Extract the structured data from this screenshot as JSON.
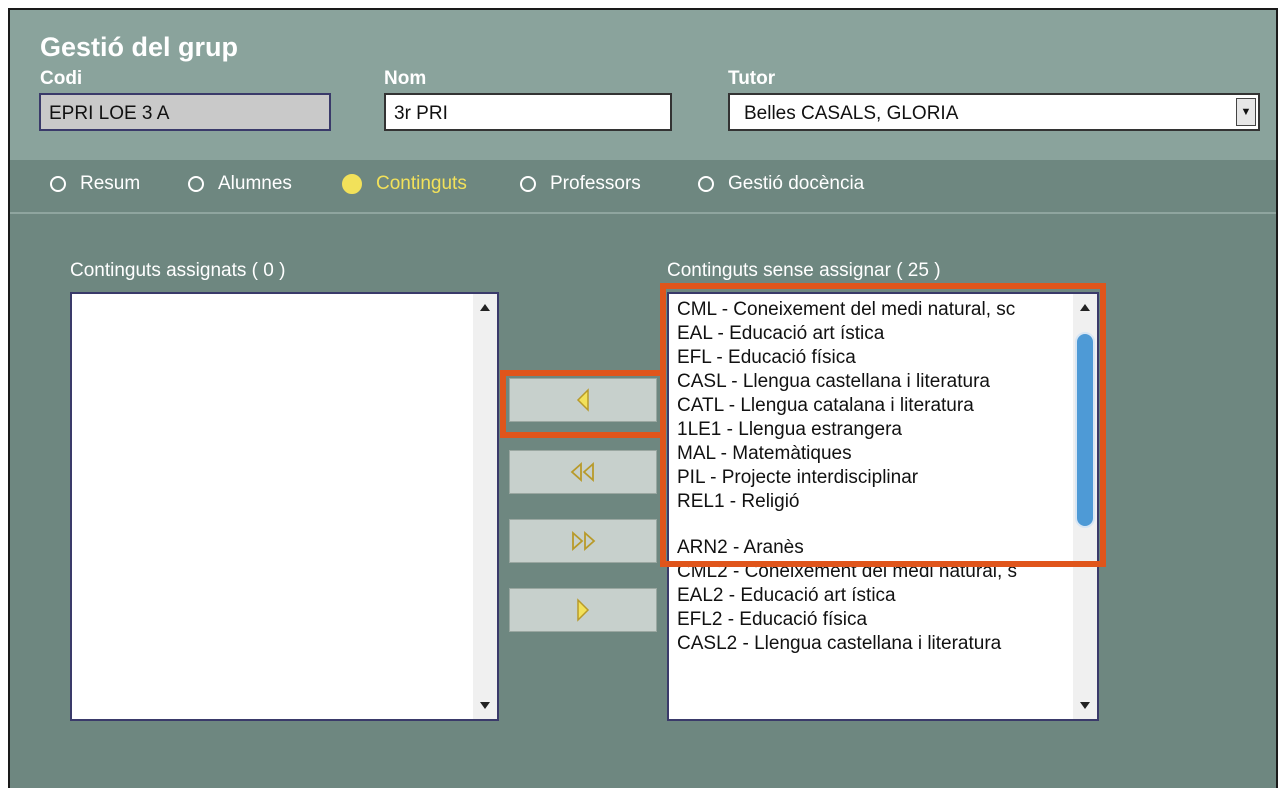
{
  "header": {
    "title": "Gestió del grup",
    "codi_label": "Codi",
    "codi_value": "EPRI LOE 3 A",
    "nom_label": "Nom",
    "nom_value": "3r PRI",
    "tutor_label": "Tutor",
    "tutor_value": "Belles CASALS, GLORIA"
  },
  "tabs": [
    {
      "label": "Resum",
      "selected": false
    },
    {
      "label": "Alumnes",
      "selected": false
    },
    {
      "label": "Continguts",
      "selected": true
    },
    {
      "label": "Professors",
      "selected": false
    },
    {
      "label": "Gestió docència",
      "selected": false
    }
  ],
  "assigned": {
    "label": "Continguts assignats ( 0 )",
    "items": []
  },
  "unassigned": {
    "label": "Continguts sense assignar ( 25 )",
    "items": [
      "CML - Coneixement del medi natural, sc",
      "EAL - Educació art ística",
      "EFL - Educació física",
      "CASL - Llengua castellana i literatura",
      "CATL - Llengua catalana i literatura",
      "1LE1 - Llengua estrangera",
      "MAL - Matemàtiques",
      "PIL - Projecte interdisciplinar",
      "REL1 - Religió",
      "ARN2 - Aranès",
      "CML2 - Coneixement del medi natural, s",
      "EAL2 - Educació art ística",
      "EFL2 - Educació física",
      "CASL2 - Llengua castellana i literatura"
    ]
  },
  "colors": {
    "highlight": "#e0551b",
    "arrow": "#f2e15a",
    "active_tab": "#f2e15a"
  }
}
